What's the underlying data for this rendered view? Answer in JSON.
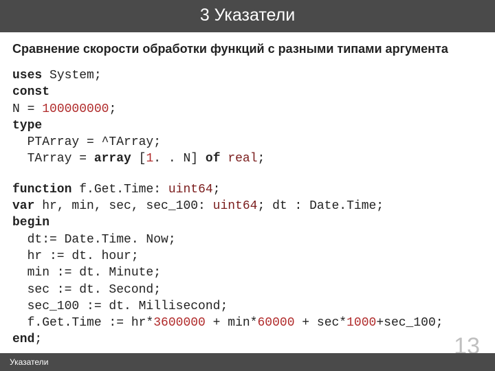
{
  "header": {
    "title": "3 Указатели"
  },
  "subtitle": "Сравнение скорости обработки функций с разными типами аргумента",
  "code1": {
    "l1_kw": "uses",
    "l1_rest": " System;",
    "l2_kw": "const",
    "l3_a": "N = ",
    "l3_num": "100000000",
    "l3_b": ";",
    "l4_kw": "type",
    "l5": "  PTArray = ^TArray;",
    "l6_a": "  TArray = ",
    "l6_kw1": "array",
    "l6_b": " [",
    "l6_n1": "1",
    "l6_c": ". . N] ",
    "l6_kw2": "of",
    "l6_d": " ",
    "l6_typ": "real",
    "l6_e": ";"
  },
  "code2": {
    "l1_kw": "function",
    "l1_a": " f.Get.Time: ",
    "l1_typ": "uint64",
    "l1_b": ";",
    "l2_kw": "var",
    "l2_a": " hr, min, sec, sec_100: ",
    "l2_typ": "uint64",
    "l2_b": "; dt : Date.Time;",
    "l3_kw": "begin",
    "l4": "  dt:= Date.Time. Now;",
    "l5": "  hr := dt. hour;",
    "l6": "  min := dt. Minute;",
    "l7": "  sec := dt. Second;",
    "l8": "  sec_100 := dt. Millisecond;",
    "l9_a": "  f.Get.Time := hr*",
    "l9_n1": "3600000",
    "l9_b": " + min*",
    "l9_n2": "60000",
    "l9_c": " + sec*",
    "l9_n3": "1000",
    "l9_d": "+sec_100;",
    "l10_kw": "end",
    "l10_a": ";"
  },
  "footer": {
    "label": "Указатели"
  },
  "page_number": "13"
}
